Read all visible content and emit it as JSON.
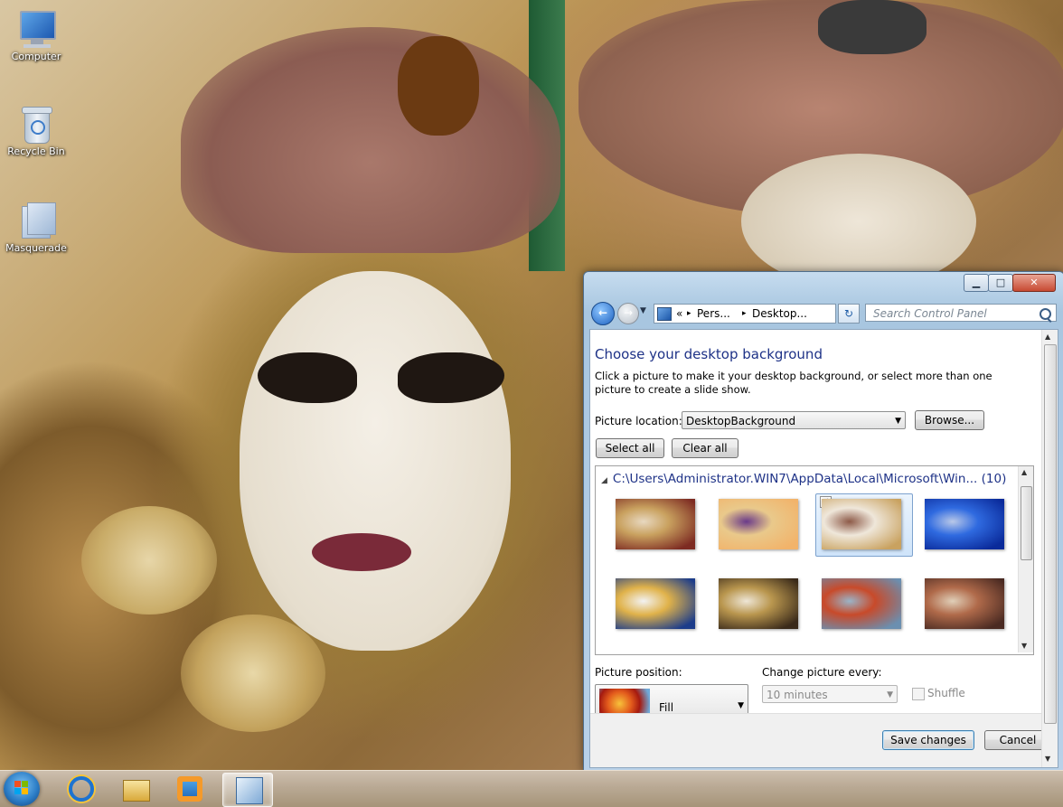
{
  "desktop": {
    "icons": [
      {
        "label": "Computer",
        "icon": "computer-icon"
      },
      {
        "label": "Recycle Bin",
        "icon": "recycle-bin-icon"
      },
      {
        "label": "Masquerade",
        "icon": "theme-pack-icon"
      }
    ]
  },
  "window": {
    "controls": {
      "minimize": "▁",
      "maximize": "□",
      "close": "✕"
    },
    "nav": {
      "back": "←",
      "forward": "→",
      "recent": "▼"
    },
    "address": {
      "prefix": "«",
      "segments": [
        "Pers...",
        "Desktop..."
      ],
      "separator": "▸",
      "dropdown": "▼"
    },
    "refresh": "↻",
    "search_placeholder": "Search Control Panel",
    "title": "Choose your desktop background",
    "description": "Click a picture to make it your desktop background, or select more than one picture to create a slide show.",
    "location_label": "Picture location:",
    "location_value": "DesktopBackground",
    "browse_label": "Browse...",
    "select_all_label": "Select all",
    "clear_all_label": "Clear all",
    "group_path": "C:\\Users\\Administrator.WIN7\\AppData\\Local\\Microsoft\\Win...",
    "group_count": "(10)",
    "group_toggle": "◢",
    "check_mark": "✓",
    "thumbnails": [
      {
        "name": "wallpaper-1",
        "colors": [
          "#7d2b22",
          "#c9a15f",
          "#e8d8c0"
        ]
      },
      {
        "name": "wallpaper-2",
        "colors": [
          "#f2b36a",
          "#e9c98b",
          "#6a3a8a"
        ]
      },
      {
        "name": "wallpaper-3",
        "colors": [
          "#c9a260",
          "#efe7da",
          "#8d5a48"
        ],
        "selected": true
      },
      {
        "name": "wallpaper-4",
        "colors": [
          "#0a2a9a",
          "#2f6ae0",
          "#b9c8e8"
        ]
      },
      {
        "name": "wallpaper-5",
        "colors": [
          "#1c3c8a",
          "#e0b24a",
          "#f2f2f2"
        ]
      },
      {
        "name": "wallpaper-6",
        "colors": [
          "#3a2a1a",
          "#b9964e",
          "#eee6d6"
        ]
      },
      {
        "name": "wallpaper-7",
        "colors": [
          "#6b8fb0",
          "#c84a2a",
          "#9ab4c8"
        ]
      },
      {
        "name": "wallpaper-8",
        "colors": [
          "#4a2a22",
          "#b06a4a",
          "#e0cfb8"
        ]
      }
    ],
    "position_label": "Picture position:",
    "position_value": "Fill",
    "change_label": "Change picture every:",
    "change_value": "10 minutes",
    "shuffle_label": "Shuffle",
    "shuffle_checked": false,
    "save_label": "Save changes",
    "cancel_label": "Cancel",
    "scroll": {
      "up": "▲",
      "down": "▼"
    }
  },
  "taskbar": {
    "items": [
      {
        "name": "internet-explorer",
        "icon": "internet-explorer-icon"
      },
      {
        "name": "windows-explorer",
        "icon": "folder-icon"
      },
      {
        "name": "windows-media-player",
        "icon": "media-player-icon"
      },
      {
        "name": "control-panel",
        "icon": "control-panel-icon",
        "active": true
      }
    ]
  },
  "colors": {
    "title_blue": "#1e3287",
    "window_frame": "#b9d1e8",
    "close_red": "#c74a32"
  }
}
